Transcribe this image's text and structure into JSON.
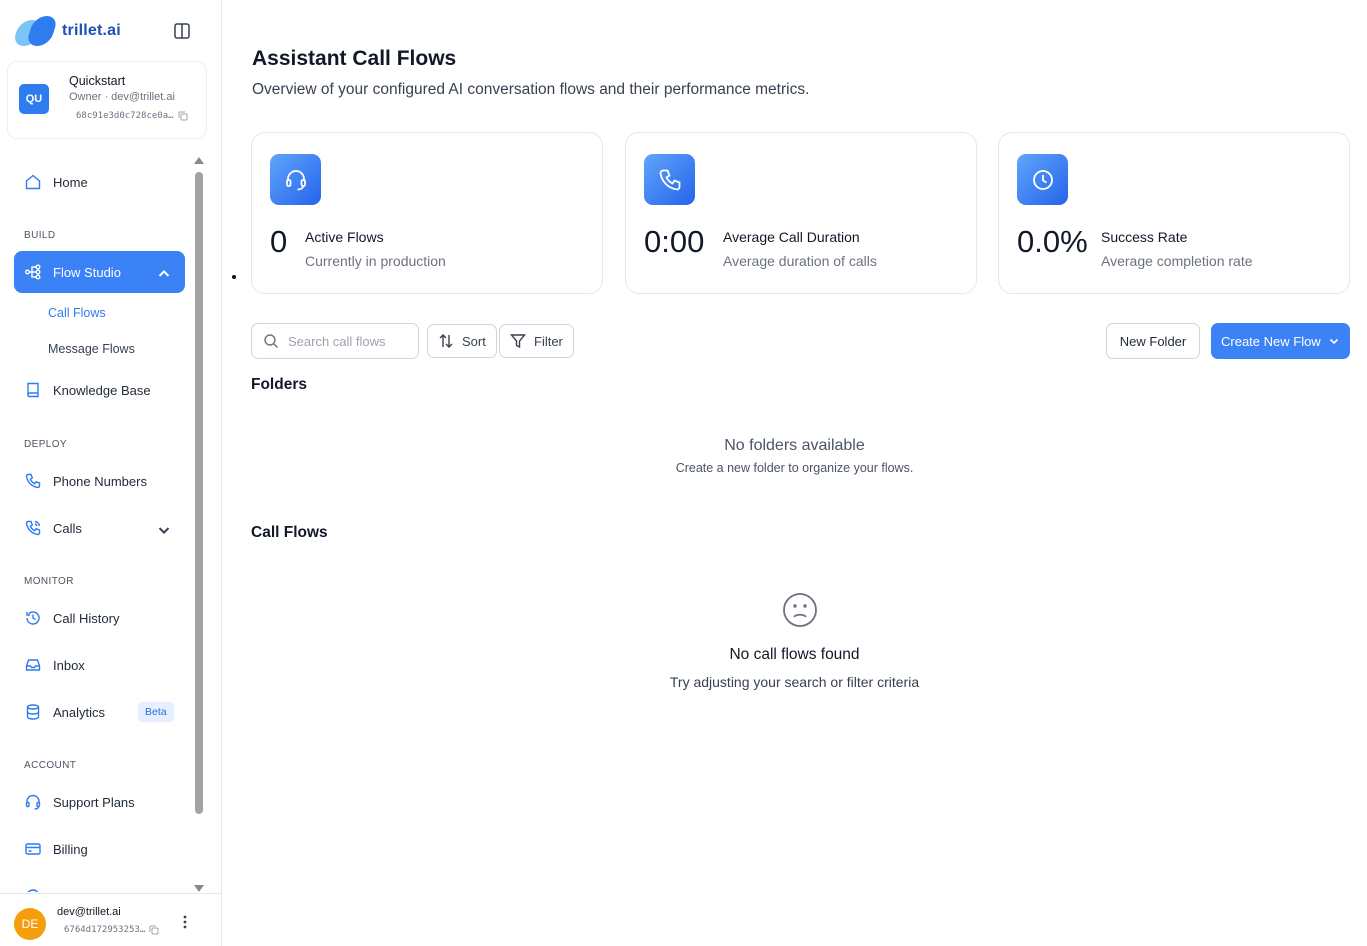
{
  "brand": {
    "name": "trillet.ai"
  },
  "workspace": {
    "initials": "QU",
    "name": "Quickstart",
    "role": "Owner  ·  dev@trillet.ai",
    "id": "68c91e3d0c728ce0a…"
  },
  "nav": {
    "home": "Home",
    "section_build": "BUILD",
    "flow_studio": "Flow Studio",
    "call_flows": "Call Flows",
    "message_flows": "Message Flows",
    "knowledge_base": "Knowledge Base",
    "section_deploy": "DEPLOY",
    "phone_numbers": "Phone Numbers",
    "calls": "Calls",
    "section_monitor": "MONITOR",
    "call_history": "Call History",
    "inbox": "Inbox",
    "analytics": "Analytics",
    "analytics_badge": "Beta",
    "section_account": "ACCOUNT",
    "support_plans": "Support Plans",
    "billing": "Billing"
  },
  "user": {
    "initials": "DE",
    "email": "dev@trillet.ai",
    "id": "6764d172953253…"
  },
  "header": {
    "title": "Assistant Call Flows",
    "subtitle": "Overview of your configured AI conversation flows and their performance metrics."
  },
  "stats": [
    {
      "value": "0",
      "label": "Active Flows",
      "desc": "Currently in production",
      "icon": "headset-icon"
    },
    {
      "value": "0:00",
      "label": "Average Call Duration",
      "desc": "Average duration of calls",
      "icon": "phone-icon"
    },
    {
      "value": "0.0%",
      "label": "Success Rate",
      "desc": "Average completion rate",
      "icon": "clock-icon"
    }
  ],
  "toolbar": {
    "search_placeholder": "Search call flows",
    "sort": "Sort",
    "filter": "Filter",
    "new_folder": "New Folder",
    "create_new_flow": "Create New Flow"
  },
  "folders": {
    "title": "Folders",
    "empty_title": "No folders available",
    "empty_desc": "Create a new folder to organize your flows."
  },
  "call_flows": {
    "title": "Call Flows",
    "empty_title": "No call flows found",
    "empty_desc": "Try adjusting your search or filter criteria"
  },
  "colors": {
    "accent": "#3b82f6",
    "avatar_user": "#f59e0b"
  }
}
